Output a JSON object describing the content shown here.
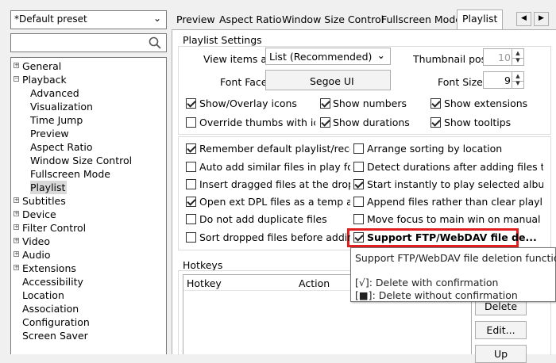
{
  "preset": {
    "value": "*Default preset"
  },
  "search": {
    "placeholder": ""
  },
  "tree": [
    {
      "label": "General",
      "level": 0,
      "expander": "+"
    },
    {
      "label": "Playback",
      "level": 0,
      "expander": "-"
    },
    {
      "label": "Advanced",
      "level": 1
    },
    {
      "label": "Visualization",
      "level": 1
    },
    {
      "label": "Time Jump",
      "level": 1
    },
    {
      "label": "Preview",
      "level": 1
    },
    {
      "label": "Aspect Ratio",
      "level": 1
    },
    {
      "label": "Window Size Control",
      "level": 1
    },
    {
      "label": "Fullscreen Mode",
      "level": 1
    },
    {
      "label": "Playlist",
      "level": 1,
      "selected": true
    },
    {
      "label": "Subtitles",
      "level": 0,
      "expander": "+"
    },
    {
      "label": "Device",
      "level": 0,
      "expander": "+"
    },
    {
      "label": "Filter Control",
      "level": 0,
      "expander": "+"
    },
    {
      "label": "Video",
      "level": 0,
      "expander": "+"
    },
    {
      "label": "Audio",
      "level": 0,
      "expander": "+"
    },
    {
      "label": "Extensions",
      "level": 0,
      "expander": "+"
    },
    {
      "label": "Accessibility",
      "level": 0
    },
    {
      "label": "Location",
      "level": 0
    },
    {
      "label": "Association",
      "level": 0
    },
    {
      "label": "Configuration",
      "level": 0
    },
    {
      "label": "Screen Saver",
      "level": 0
    }
  ],
  "tabs": {
    "preview": "Preview",
    "aspect": "Aspect Ratio",
    "window": "Window Size Control",
    "fullscreen": "Fullscreen Mode",
    "playlist": "Playlist",
    "prev": "◀",
    "next": "▶"
  },
  "playlist_settings": {
    "title": "Playlist Settings",
    "view_items_label": "View items as:",
    "view_items_value": "List (Recommended)",
    "thumb_label": "Thumbnail pos.",
    "thumb_value": "10",
    "font_face_label": "Font Face:",
    "font_face_value": "Segoe UI",
    "font_size_label": "Font Size:",
    "font_size_value": "9",
    "checks": {
      "show_overlay": {
        "label": "Show/Overlay icons",
        "checked": true
      },
      "show_numbers": {
        "label": "Show numbers",
        "checked": true
      },
      "show_extensions": {
        "label": "Show extensions",
        "checked": true
      },
      "override_thumbs": {
        "label": "Override thumbs with ico...",
        "checked": false
      },
      "show_durations": {
        "label": "Show durations",
        "checked": true
      },
      "show_tooltips": {
        "label": "Show tooltips",
        "checked": true
      }
    }
  },
  "options": [
    {
      "label": "Remember default playlist/recent ...",
      "checked": true
    },
    {
      "label": "Arrange sorting by location",
      "checked": false
    },
    {
      "label": "Auto add similar files in play folder",
      "checked": false
    },
    {
      "label": "Detect durations after adding files t...",
      "checked": false
    },
    {
      "label": "Insert dragged files at the drop p...",
      "checked": false
    },
    {
      "label": "Start instantly to play selected albums",
      "checked": true
    },
    {
      "label": "Open ext DPL files as a temp albu...",
      "checked": true
    },
    {
      "label": "Append files rather than clear playlist",
      "checked": false
    },
    {
      "label": "Do not add duplicate files",
      "checked": false
    },
    {
      "label": "Move focus to main win on manual ...",
      "checked": false
    },
    {
      "label": "Sort dropped files before adding t...",
      "checked": false
    },
    {
      "label": "Support FTP/WebDAV file de...",
      "checked": true
    }
  ],
  "hotkeys": {
    "title": "Hotkeys",
    "col_hotkey": "Hotkey",
    "col_action": "Action",
    "delete_label": "Delete",
    "edit_label": "Edit...",
    "up_label": "Up"
  },
  "tooltip": {
    "line1": "Support FTP/WebDAV file deletion function",
    "line2": "[√]: Delete with confirmation",
    "line3": "[■]: Delete without confirmation"
  }
}
